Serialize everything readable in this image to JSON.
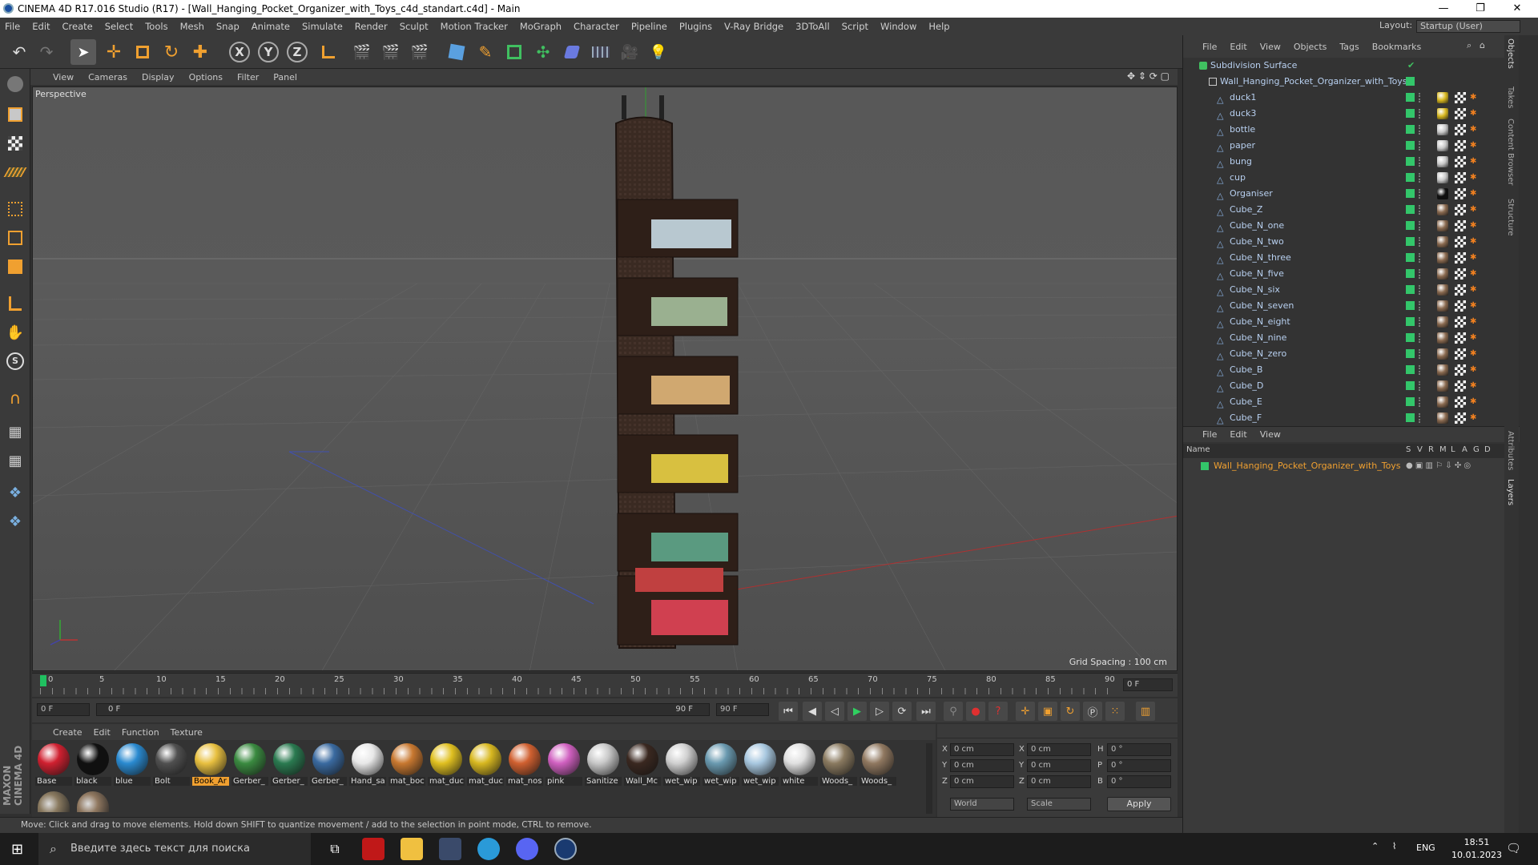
{
  "window": {
    "title": "CINEMA 4D R17.016 Studio (R17) - [Wall_Hanging_Pocket_Organizer_with_Toys_c4d_standart.c4d] - Main",
    "controls": [
      "—",
      "❐",
      "✕"
    ]
  },
  "menubar": {
    "items": [
      "File",
      "Edit",
      "Create",
      "Select",
      "Tools",
      "Mesh",
      "Snap",
      "Animate",
      "Simulate",
      "Render",
      "Sculpt",
      "Motion Tracker",
      "MoGraph",
      "Character",
      "Pipeline",
      "Plugins",
      "V-Ray Bridge",
      "3DToAll",
      "Script",
      "Window",
      "Help"
    ],
    "layout_label": "Layout:",
    "layout_value": "Startup (User)"
  },
  "toolbar": {
    "axis_x": "X",
    "axis_y": "Y",
    "axis_z": "Z"
  },
  "viewport": {
    "menu": [
      "View",
      "Cameras",
      "Display",
      "Options",
      "Filter",
      "Panel"
    ],
    "camera_label": "Perspective",
    "grid_spacing": "Grid Spacing : 100 cm"
  },
  "timeline": {
    "ticks": [
      "0",
      "5",
      "10",
      "15",
      "20",
      "25",
      "30",
      "35",
      "40",
      "45",
      "50",
      "55",
      "60",
      "65",
      "70",
      "75",
      "80",
      "85",
      "90"
    ],
    "current_frame": "0 F"
  },
  "transport": {
    "start_field": "0 F",
    "range_start": "0 F",
    "range_end": "90 F",
    "end_field": "90 F"
  },
  "material_manager": {
    "menu": [
      "Create",
      "Edit",
      "Function",
      "Texture"
    ],
    "materials": [
      {
        "label": "Base",
        "color": "#d02030",
        "highlight": false
      },
      {
        "label": "black",
        "color": "#101010",
        "highlight": false
      },
      {
        "label": "blue",
        "color": "#2a8ad0",
        "highlight": false
      },
      {
        "label": "Bolt",
        "color": "#505050",
        "highlight": false
      },
      {
        "label": "Book_Ar",
        "color": "#e8c040",
        "highlight": true
      },
      {
        "label": "Gerber_",
        "color": "#3a8a40",
        "highlight": false
      },
      {
        "label": "Gerber_",
        "color": "#2a7a50",
        "highlight": false
      },
      {
        "label": "Gerber_",
        "color": "#3a6aa0",
        "highlight": false
      },
      {
        "label": "Hand_sa",
        "color": "#e8e8e8",
        "highlight": false
      },
      {
        "label": "mat_boc",
        "color": "#c87830",
        "highlight": false
      },
      {
        "label": "mat_duc",
        "color": "#e0c020",
        "highlight": false
      },
      {
        "label": "mat_duc",
        "color": "#d8b820",
        "highlight": false
      },
      {
        "label": "mat_nos",
        "color": "#d06030",
        "highlight": false
      },
      {
        "label": "pink",
        "color": "#d060c0",
        "highlight": false
      },
      {
        "label": "Sanitize",
        "color": "#c8c8c8",
        "highlight": false
      },
      {
        "label": "Wall_Mc",
        "color": "#3a2820",
        "highlight": false
      },
      {
        "label": "wet_wip",
        "color": "#d0d0d0",
        "highlight": false
      },
      {
        "label": "wet_wip",
        "color": "#6a9ab0",
        "highlight": false
      },
      {
        "label": "wet_wip",
        "color": "#a8c8e0",
        "highlight": false
      },
      {
        "label": "white",
        "color": "#e0e0e0",
        "highlight": false
      },
      {
        "label": "Woods_",
        "color": "#8a7a60",
        "highlight": false
      },
      {
        "label": "Woods_",
        "color": "#907860",
        "highlight": false
      }
    ]
  },
  "coordinates": {
    "pos_x": "0 cm",
    "pos_y": "0 cm",
    "pos_z": "0 cm",
    "size_x": "0 cm",
    "size_y": "0 cm",
    "size_z": "0 cm",
    "rot_h": "0 °",
    "rot_p": "0 °",
    "rot_b": "0 °",
    "label_x": "X",
    "label_y": "Y",
    "label_z": "Z",
    "label_h": "H",
    "label_p": "P",
    "label_b": "B",
    "mode_world": "World",
    "mode_scale": "Scale",
    "apply": "Apply"
  },
  "status": "Move: Click and drag to move elements. Hold down SHIFT to quantize movement / add to the selection in point mode, CTRL to remove.",
  "object_manager": {
    "menu": [
      "File",
      "Edit",
      "View",
      "Objects",
      "Tags",
      "Bookmarks"
    ],
    "root": "Subdivision Surface",
    "group": "Wall_Hanging_Pocket_Organizer_with_Toys",
    "objects": [
      {
        "name": "duck1",
        "mat": "#d8b820"
      },
      {
        "name": "duck3",
        "mat": "#d8b820"
      },
      {
        "name": "bottle",
        "mat": "#c8c8c8"
      },
      {
        "name": "paper",
        "mat": "#c8c8c8"
      },
      {
        "name": "bung",
        "mat": "#c8c8c8"
      },
      {
        "name": "cup",
        "mat": "#c8c8c8"
      },
      {
        "name": "Organiser",
        "mat": "#101010"
      },
      {
        "name": "Cube_Z",
        "mat": "#8a6a50"
      },
      {
        "name": "Cube_N_one",
        "mat": "#8a6a50"
      },
      {
        "name": "Cube_N_two",
        "mat": "#8a6a50"
      },
      {
        "name": "Cube_N_three",
        "mat": "#8a6a50"
      },
      {
        "name": "Cube_N_five",
        "mat": "#8a6a50"
      },
      {
        "name": "Cube_N_six",
        "mat": "#8a6a50"
      },
      {
        "name": "Cube_N_seven",
        "mat": "#8a6a50"
      },
      {
        "name": "Cube_N_eight",
        "mat": "#8a6a50"
      },
      {
        "name": "Cube_N_nine",
        "mat": "#8a6a50"
      },
      {
        "name": "Cube_N_zero",
        "mat": "#8a6a50"
      },
      {
        "name": "Cube_B",
        "mat": "#8a6a50"
      },
      {
        "name": "Cube_D",
        "mat": "#8a6a50"
      },
      {
        "name": "Cube_E",
        "mat": "#8a6a50"
      },
      {
        "name": "Cube_F",
        "mat": "#8a6a50"
      }
    ]
  },
  "layer_manager": {
    "menu": [
      "File",
      "Edit",
      "View"
    ],
    "columns": [
      "Name",
      "S",
      "V",
      "R",
      "M",
      "L",
      "A",
      "G",
      "D"
    ],
    "layer": "Wall_Hanging_Pocket_Organizer_with_Toys"
  },
  "side_tabs": [
    "Objects",
    "Takes",
    "Content Browser",
    "Structure",
    "Attributes",
    "Layers"
  ],
  "taskbar": {
    "search_placeholder": "Введите здесь текст для поиска",
    "lang": "ENG",
    "time": "18:51",
    "date": "10.01.2023"
  },
  "colors": {
    "accent_orange": "#f0a030",
    "tag_green": "#33c66a",
    "object_text": "#b8d0f0"
  }
}
